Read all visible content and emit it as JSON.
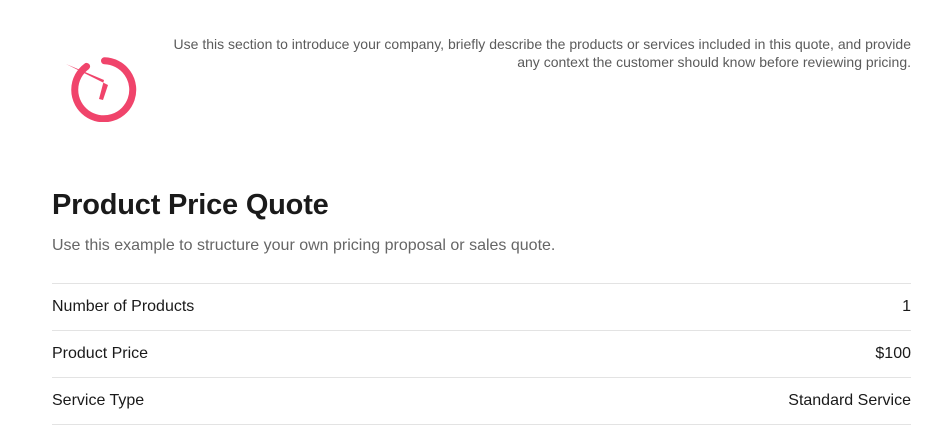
{
  "brand": {
    "accent_color": "#f0446b",
    "logo_icon": "gauge-logo-icon"
  },
  "header": {
    "intro_text": "Use this section to introduce your company, briefly describe the products or services included in this quote, and provide any context the customer should know before reviewing pricing."
  },
  "quote": {
    "title": "Product Price Quote",
    "subtitle": "Use this example to structure your own pricing proposal or sales quote.",
    "rows": [
      {
        "label": "Number of Products",
        "value": "1"
      },
      {
        "label": "Product Price",
        "value": "$100"
      },
      {
        "label": "Service Type",
        "value": "Standard Service"
      }
    ]
  }
}
